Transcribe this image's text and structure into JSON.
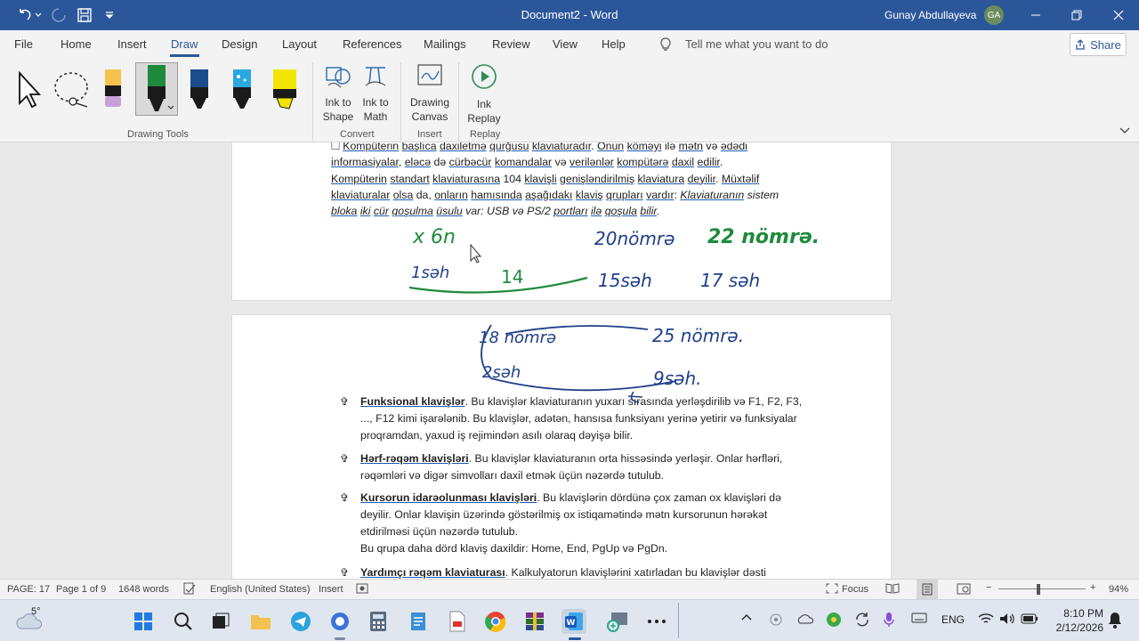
{
  "titlebar": {
    "title": "Document2 - Word",
    "user": "Gunay Abdullayeva",
    "initials": "GA"
  },
  "menu": {
    "file": "File",
    "home": "Home",
    "insert": "Insert",
    "draw": "Draw",
    "design": "Design",
    "layout": "Layout",
    "references": "References",
    "mailings": "Mailings",
    "review": "Review",
    "view": "View",
    "help": "Help",
    "tell_me": "Tell me what you want to do",
    "share": "Share"
  },
  "ribbon": {
    "ink_to_shape": [
      "Ink to",
      "Shape"
    ],
    "ink_to_math": [
      "Ink to",
      "Math"
    ],
    "drawing_canvas": [
      "Drawing",
      "Canvas"
    ],
    "ink_replay": [
      "Ink",
      "Replay"
    ],
    "group_drawing_tools": "Drawing Tools",
    "group_convert": "Convert",
    "group_insert": "Insert",
    "group_replay": "Replay"
  },
  "page1": {
    "prefix": "🞎",
    "l1a": "Kompüterin",
    "l1b": " ",
    "l1c": "başlıca",
    "l1d": " ",
    "l1e": "daxiletmə",
    "l1f": " ",
    "l1g": "qurğusu",
    "l1h": " ",
    "l1i": "klaviaturadır",
    "l1j": ". ",
    "l1k": "Onun",
    "l1l": " ",
    "l1m": "köməyi",
    "l1n": " ilə ",
    "l1o": "mətn",
    "l1p": " və ",
    "l1q": "ədədi",
    "l2a": "informasiyalar",
    "l2b": ", ",
    "l2c": "eləcə",
    "l2d": " də ",
    "l2e": "cürbəcür",
    "l2f": " ",
    "l2g": "komandalar",
    "l2h": " və ",
    "l2i": "verilənlər",
    "l2j": " ",
    "l2k": "kompütərə",
    "l2l": " ",
    "l2m": "daxil",
    "l2n": " ",
    "l2o": "edilir",
    "l3a": "Kompüterin",
    "l3b": " ",
    "l3c": "standart",
    "l3d": " ",
    "l3e": "klaviaturasına",
    "l3f": " 104 ",
    "l3g": "klavişli",
    "l3h": " ",
    "l3i": "genişləndirilmiş",
    "l3j": " ",
    "l3k": "klaviatura",
    "l3l": " ",
    "l3m": "deyilir",
    "l3n": ". ",
    "l3o": "Müxtəlif",
    "l4a": "klaviaturalar",
    "l4b": " ",
    "l4c": "olsa",
    "l4d": " da, ",
    "l4e": "onların",
    "l4f": " ",
    "l4g": "hamısında",
    "l4h": " ",
    "l4i": "aşağıdakı",
    "l4j": " ",
    "l4k": "klaviş",
    "l4l": " ",
    "l4m": "qrupları",
    "l4n": " ",
    "l4o": "vardır",
    "l4p": ": ",
    "l4q": "Klaviaturanın",
    "l4r": " ",
    "l4s": "sistem",
    "l5a": "bloka",
    "l5b": " ",
    "l5c": "iki",
    "l5d": " ",
    "l5e": "cür",
    "l5f": " ",
    "l5g": "qoşulma",
    "l5h": " ",
    "l5i": "üsulu",
    "l5j": " var: USB ",
    "l5k": "və",
    "l5l": " PS/2 ",
    "l5m": "portları",
    "l5n": " ",
    "l5o": "ilə",
    "l5p": " ",
    "l5q": "qoşula",
    "l5r": " ",
    "l5s": "bilir"
  },
  "bullets": {
    "symbol": "✞",
    "b1_title": "Funksional klavişlər",
    "b1_l1": ". Bu klavişlər klaviaturanın yuxarı sırasında yerləşdirilib və F1, F2, F3,",
    "b1_l2": "..., F12 kimi işarələnib. Bu klavişlər, adətən, hansısa funksiyanı yerinə yetirir və funksiyalar",
    "b1_l3": "proqramdan, yaxud iş rejimindən asılı olaraq dəyişə bilir.",
    "b2_title": "Hərf-rəqəm klavişləri",
    "b2_l1": ". Bu klavişlər klaviaturanın orta hissəsində yerləşir. Onlar hərfləri,",
    "b2_l2": "rəqəmləri və digər simvolları daxil etmək üçün nəzərdə tutulub.",
    "b3_title": "Kursorun idarəolunması klavişləri",
    "b3_l1": ". Bu klavişlərin dördünə çox zaman ox klavişləri də",
    "b3_l2": "deyilir. Onlar klavişin üzərində göstərilmiş ox istiqamətində mətn kursorunun hərəkət",
    "b3_l3": "etdirilməsi üçün nəzərdə tutulub.",
    "b3_l4": "Bu qrupa daha dörd klaviş daxildir: Home, End, PgUp və PgDn.",
    "b4_title": "Yardımçı rəqəm klaviaturası",
    "b4_l1": ". Kalkulyatorun klavişlərini xatırladan bu klavişlər dəsti"
  },
  "ink": {
    "x6n": "x 6n",
    "n20": "20nömrə",
    "n22": "22 nömrə.",
    "s1": "1səh",
    "n14": "14",
    "s15": "15səh",
    "s17": "17 səh",
    "n18": "18 nömrə",
    "n25": "25 nömrə.",
    "s2": "2səh",
    "s9": "9səh."
  },
  "colors": {
    "ink_green": "#1f8a3b",
    "ink_blue": "#1f3f8a",
    "word_blue": "#2b579a"
  },
  "status": {
    "page": "PAGE: 17",
    "pageof": "Page 1 of 9",
    "words": "1648 words",
    "lang": "English (United States)",
    "mode": "Insert",
    "focus": "Focus",
    "zoom": "94%"
  },
  "taskbar": {
    "temp": "5°",
    "lang": "ENG",
    "time": "8:10 PM",
    "date": "2/12/2026"
  },
  "icons": [
    "undo-icon",
    "redo-icon",
    "save-icon",
    "customize-icon",
    "minimize-icon",
    "restore-icon",
    "close-icon",
    "lightbulb-icon",
    "share-icon",
    "select-arrow-icon",
    "lasso-icon",
    "pencil-icon",
    "pen-icon",
    "highlighter-icon",
    "ink-to-shape-icon",
    "ink-to-math-icon",
    "drawing-canvas-icon",
    "ink-replay-icon",
    "windows-icon",
    "search-icon",
    "wifi-icon",
    "volume-icon",
    "battery-icon"
  ]
}
